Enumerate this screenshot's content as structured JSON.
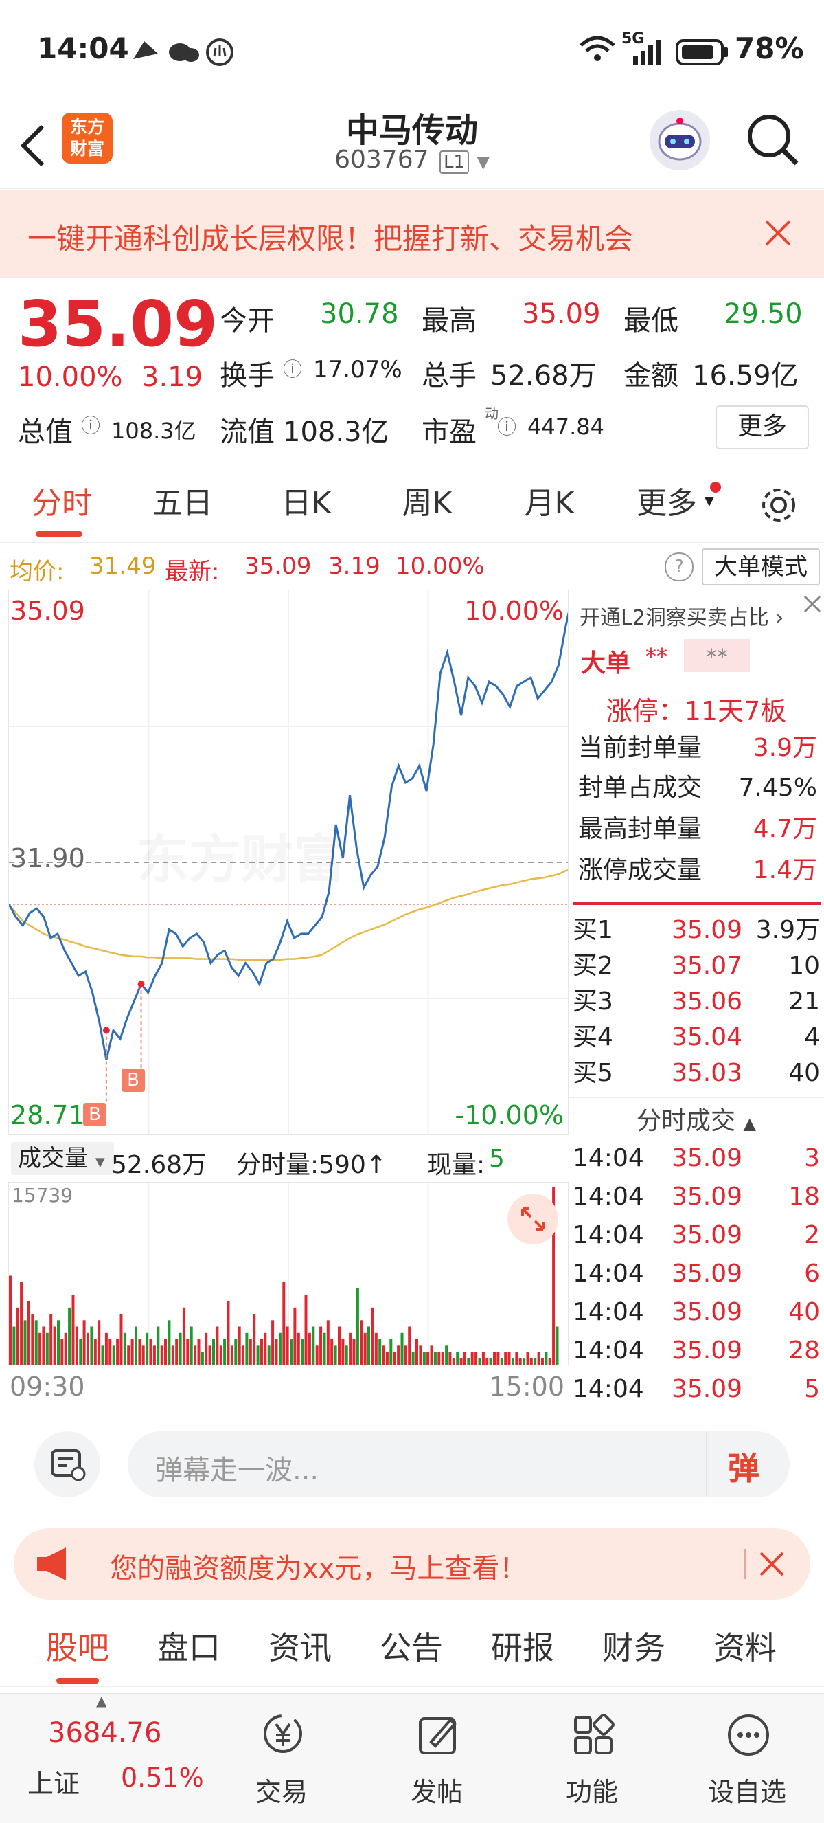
{
  "status": {
    "time": "14:04",
    "network": "5G",
    "battery": "78%"
  },
  "header": {
    "title": "中马传动",
    "code": "603767",
    "level": "L1",
    "logo_line1": "东方",
    "logo_line2": "财富"
  },
  "banner": {
    "text": "一键开通科创成长层权限！把握打新、交易机会"
  },
  "quote": {
    "price": "35.09",
    "change_pct": "10.00%",
    "change": "3.19",
    "open_label": "今开",
    "open": "30.78",
    "high_label": "最高",
    "high": "35.09",
    "low_label": "最低",
    "low": "29.50",
    "turnover_label": "换手",
    "turnover": "17.07%",
    "volume_label": "总手",
    "volume": "52.68万",
    "amount_label": "金额",
    "amount": "16.59亿",
    "mktcap_label": "总值",
    "mktcap": "108.3亿",
    "float_label": "流值",
    "float": "108.3亿",
    "pe_label": "市盈",
    "pe_sup": "动",
    "pe": "447.84",
    "more_button": "更多"
  },
  "chart_tabs": [
    "分时",
    "五日",
    "日K",
    "周K",
    "月K",
    "更多"
  ],
  "info": {
    "avg_label": "均价:",
    "avg": "31.49",
    "latest_label": "最新:",
    "latest": "35.09",
    "chg": "3.19",
    "pct": "10.00%",
    "mode_button": "大单模式"
  },
  "chart_data": {
    "type": "line",
    "price_axis": {
      "top": "35.09",
      "mid": "31.90",
      "bottom": "28.71",
      "top_pct": "10.00%",
      "bottom_pct": "-10.00%",
      "ylim": [
        28.71,
        35.09
      ],
      "prev_close": 31.9
    },
    "time_axis": {
      "start": "09:30",
      "end": "15:00"
    },
    "watermark": "东方财富",
    "markers": [
      "B",
      "B"
    ],
    "price_series": [
      31.4,
      31.25,
      31.15,
      31.3,
      31.35,
      31.25,
      31.0,
      31.05,
      30.85,
      30.7,
      30.55,
      30.6,
      30.35,
      30.0,
      29.55,
      29.9,
      29.8,
      30.05,
      30.25,
      30.45,
      30.35,
      30.55,
      30.7,
      31.1,
      31.05,
      30.9,
      31.0,
      31.05,
      30.95,
      30.7,
      30.8,
      30.85,
      30.65,
      30.55,
      30.7,
      30.6,
      30.45,
      30.7,
      30.75,
      30.95,
      31.2,
      31.0,
      31.05,
      31.05,
      31.15,
      31.25,
      31.55,
      32.35,
      31.95,
      32.7,
      32.05,
      31.6,
      31.75,
      31.85,
      32.2,
      32.8,
      33.05,
      32.85,
      32.9,
      33.05,
      32.75,
      33.3,
      34.15,
      34.4,
      34.05,
      33.65,
      34.1,
      34.0,
      33.8,
      34.05,
      34.0,
      33.9,
      33.75,
      34.0,
      34.05,
      34.1,
      33.85,
      33.95,
      34.05,
      34.25,
      34.7,
      35.09,
      35.09
    ],
    "avg_series": [
      31.4,
      31.3,
      31.2,
      31.15,
      31.1,
      31.05,
      31.02,
      31.0,
      30.98,
      30.95,
      30.93,
      30.9,
      30.88,
      30.86,
      30.84,
      30.82,
      30.8,
      30.79,
      30.78,
      30.78,
      30.77,
      30.77,
      30.76,
      30.76,
      30.76,
      30.76,
      30.76,
      30.75,
      30.75,
      30.75,
      30.75,
      30.75,
      30.75,
      30.74,
      30.74,
      30.74,
      30.74,
      30.74,
      30.74,
      30.74,
      30.75,
      30.75,
      30.76,
      30.77,
      30.78,
      30.8,
      30.85,
      30.9,
      30.95,
      31.0,
      31.04,
      31.07,
      31.1,
      31.13,
      31.16,
      31.2,
      31.24,
      31.28,
      31.31,
      31.34,
      31.36,
      31.39,
      31.42,
      31.45,
      31.48,
      31.5,
      31.52,
      31.55,
      31.57,
      31.59,
      31.61,
      31.63,
      31.64,
      31.66,
      31.68,
      31.7,
      31.71,
      31.72,
      31.74,
      31.76,
      31.8,
      31.82,
      31.83
    ],
    "volume_max_label": "15739",
    "volume_series": [
      14,
      6,
      9,
      13,
      7,
      10,
      8,
      7,
      5,
      6,
      5,
      8,
      6,
      7,
      4,
      5,
      9,
      11,
      6,
      4,
      7,
      5,
      6,
      4,
      7,
      3,
      5,
      4,
      3,
      4,
      8,
      5,
      3,
      4,
      6,
      4,
      3,
      5,
      4,
      3,
      6,
      3,
      4,
      7,
      3,
      4,
      5,
      9,
      4,
      6,
      3,
      4,
      2,
      5,
      3,
      4,
      6,
      3,
      4,
      10,
      3,
      4,
      6,
      3,
      5,
      4,
      8,
      3,
      4,
      5,
      3,
      7,
      4,
      5,
      13,
      6,
      4,
      9,
      5,
      4,
      11,
      5,
      6,
      3,
      6,
      5,
      7,
      4,
      3,
      6,
      4,
      3,
      5,
      4,
      12,
      7,
      5,
      6,
      9,
      5,
      4,
      3,
      2,
      4,
      2,
      3,
      5,
      3,
      6,
      2,
      4,
      3,
      2,
      2,
      3,
      2,
      2,
      2,
      3,
      2,
      1,
      2,
      1,
      2,
      1,
      2,
      2,
      1,
      2,
      1,
      1,
      2,
      2,
      1,
      2,
      2,
      1,
      2,
      1,
      1,
      2,
      1,
      1,
      2,
      1,
      2,
      1,
      28,
      6
    ]
  },
  "l2": {
    "link": "开通L2洞察买卖占比",
    "bigorder_label": "大单",
    "bigorder_a": "**",
    "bigorder_b": "**",
    "limitup": "涨停：11天7板",
    "rows": [
      {
        "label": "当前封单量",
        "value": "3.9万"
      },
      {
        "label": "封单占成交",
        "value": "7.45%"
      },
      {
        "label": "最高封单量",
        "value": "4.7万"
      },
      {
        "label": "涨停成交量",
        "value": "1.4万"
      }
    ]
  },
  "bids": [
    {
      "label": "买1",
      "price": "35.09",
      "qty": "3.9万"
    },
    {
      "label": "买2",
      "price": "35.07",
      "qty": "10"
    },
    {
      "label": "买3",
      "price": "35.06",
      "qty": "21"
    },
    {
      "label": "买4",
      "price": "35.04",
      "qty": "4"
    },
    {
      "label": "买5",
      "price": "35.03",
      "qty": "40"
    }
  ],
  "ticks_title": "分时成交",
  "ticks": [
    {
      "time": "14:04",
      "price": "35.09",
      "qty": "3"
    },
    {
      "time": "14:04",
      "price": "35.09",
      "qty": "18"
    },
    {
      "time": "14:04",
      "price": "35.09",
      "qty": "2"
    },
    {
      "time": "14:04",
      "price": "35.09",
      "qty": "6"
    },
    {
      "time": "14:04",
      "price": "35.09",
      "qty": "40"
    },
    {
      "time": "14:04",
      "price": "35.09",
      "qty": "28"
    },
    {
      "time": "14:04",
      "price": "35.09",
      "qty": "5"
    }
  ],
  "volume_bar": {
    "selector": "成交量",
    "total": "52.68万",
    "tick_label": "分时量:590↑",
    "now_label": "现量:",
    "now": "5"
  },
  "comment": {
    "placeholder": "弹幕走一波...",
    "danmu_button": "弹"
  },
  "finbanner": {
    "text": "您的融资额度为xx元，马上查看！"
  },
  "bottom_tabs": [
    "股吧",
    "盘口",
    "资讯",
    "公告",
    "研报",
    "财务",
    "资料"
  ],
  "nav": {
    "index_value": "3684.76",
    "index_name": "上证",
    "index_pct": "0.51%",
    "items": [
      "交易",
      "发帖",
      "功能",
      "设自选"
    ]
  }
}
